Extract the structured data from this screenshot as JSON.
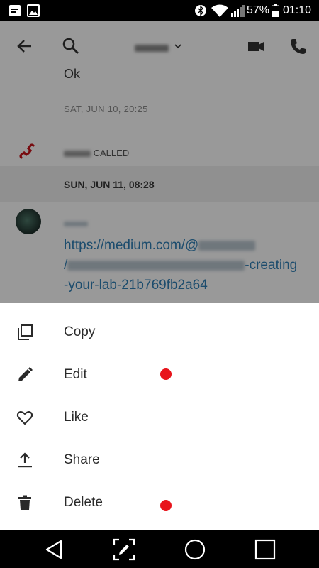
{
  "status_bar": {
    "battery_percent": "57%",
    "time": "01:10",
    "icons": [
      "notification-icon",
      "gallery-icon",
      "bluetooth-icon",
      "wifi-icon",
      "signal-icon",
      "battery-icon"
    ]
  },
  "toolbar": {
    "icons": [
      "back-arrow-icon",
      "search-icon",
      "chevron-down-icon",
      "video-call-icon",
      "phone-icon"
    ]
  },
  "chat": {
    "message_1_text": "Ok",
    "message_1_time": "SAT, JUN 10, 20:25",
    "call_event_text": "CALLED",
    "date_header": "SUN, JUN 11, 08:28",
    "link_line_1": "https://medium.com/@",
    "link_line_2_end": "-creating",
    "link_line_3": "-your-lab-21b769fb2a64"
  },
  "sheet": {
    "actions": [
      {
        "label": "Copy",
        "icon": "copy-icon"
      },
      {
        "label": "Edit",
        "icon": "pencil-icon"
      },
      {
        "label": "Like",
        "icon": "heart-icon"
      },
      {
        "label": "Share",
        "icon": "share-upload-icon"
      },
      {
        "label": "Delete",
        "icon": "trash-icon"
      }
    ],
    "accent_color": "#e8141b"
  },
  "nav_bar": {
    "buttons": [
      "back-triangle-icon",
      "edit-screen-icon",
      "home-circle-icon",
      "recents-square-icon"
    ]
  }
}
